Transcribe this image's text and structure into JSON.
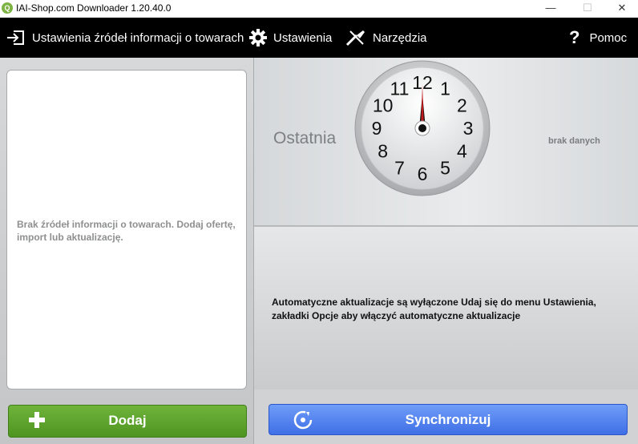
{
  "window": {
    "title": "IAI-Shop.com Downloader 1.20.40.0",
    "app_icon": "iai-logo-icon",
    "minimize": "—",
    "maximize": "☐",
    "close": "✕"
  },
  "menu": {
    "sources": "Ustawienia źródeł informacji o towarach",
    "settings": "Ustawienia",
    "tools": "Narzędzia",
    "help": "Pomoc"
  },
  "left": {
    "empty_message": "Brak źródeł informacji o towarach. Dodaj ofertę, import lub aktualizację.",
    "add_button": "Dodaj"
  },
  "right": {
    "last_label": "Ostatnia",
    "no_data": "brak danych",
    "auto_message": "Automatyczne aktualizacje są wyłączone Udaj się do menu Ustawienia, zakładki Opcje aby włączyć automatyczne aktualizacje",
    "sync_button": "Synchronizuj"
  },
  "clock": {
    "numbers": [
      "12",
      "1",
      "2",
      "3",
      "4",
      "5",
      "6",
      "7",
      "8",
      "9",
      "10",
      "11"
    ],
    "hour": 12,
    "minute": 0
  },
  "colors": {
    "add_button": "#5aa32b",
    "sync_button": "#4a7df0",
    "menubar": "#000000"
  }
}
